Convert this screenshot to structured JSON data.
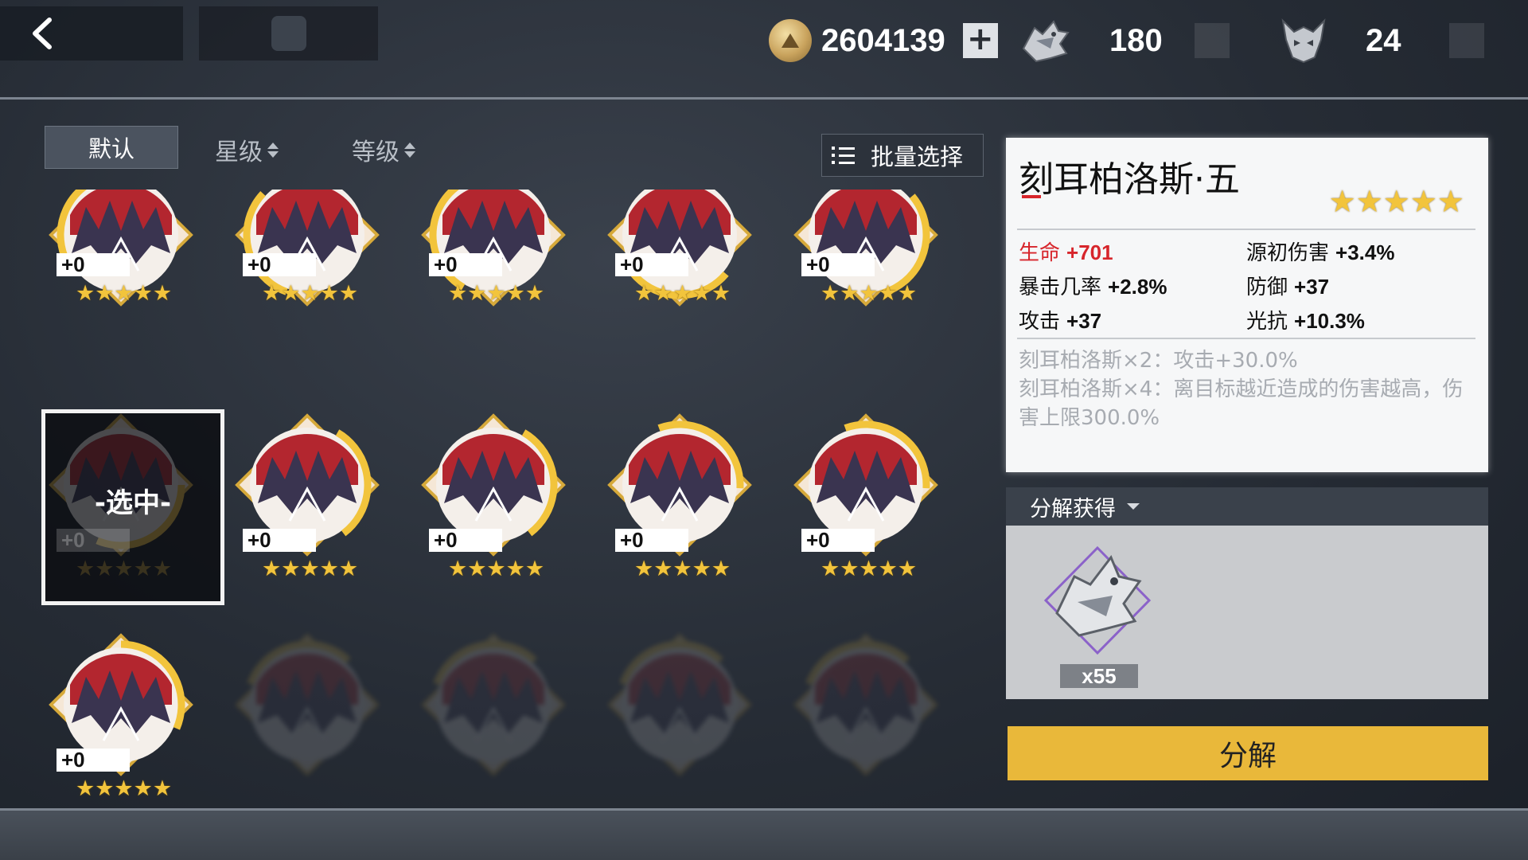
{
  "topbar": {
    "coins": "2604139",
    "dragon_currency": "180",
    "helm_currency": "24",
    "icons": {
      "back": "back-arrow-icon",
      "coin": "gold-coin-icon",
      "add": "plus-icon",
      "dragon": "dragon-crest-icon",
      "helm": "helm-crest-icon"
    }
  },
  "filters": {
    "default_label": "默认",
    "star_label": "星级",
    "level_label": "等级",
    "batch_label": "批量选择"
  },
  "grid": {
    "selected_text": "-选中-",
    "items": [
      {
        "level": "+0",
        "stars": "★★★★★",
        "selected": false
      },
      {
        "level": "+0",
        "stars": "★★★★★",
        "selected": false
      },
      {
        "level": "+0",
        "stars": "★★★★★",
        "selected": false
      },
      {
        "level": "+0",
        "stars": "★★★★★",
        "selected": false
      },
      {
        "level": "+0",
        "stars": "★★★★★",
        "selected": false
      },
      {
        "level": "+0",
        "stars": "★★★★★",
        "selected": true
      },
      {
        "level": "+0",
        "stars": "★★★★★",
        "selected": false
      },
      {
        "level": "+0",
        "stars": "★★★★★",
        "selected": false
      },
      {
        "level": "+0",
        "stars": "★★★★★",
        "selected": false
      },
      {
        "level": "+0",
        "stars": "★★★★★",
        "selected": false
      },
      {
        "level": "+0",
        "stars": "★★★★★",
        "selected": false
      }
    ]
  },
  "detail": {
    "name": "刻耳柏洛斯·五",
    "stars": "★★★★★",
    "stats": [
      {
        "label": "生命",
        "value": "+701",
        "highlight": true
      },
      {
        "label": "源初伤害",
        "value": "+3.4%",
        "highlight": false
      },
      {
        "label": "暴击几率",
        "value": "+2.8%",
        "highlight": false
      },
      {
        "label": "防御",
        "value": "+37",
        "highlight": false
      },
      {
        "label": "攻击",
        "value": "+37",
        "highlight": false
      },
      {
        "label": "光抗",
        "value": "+10.3%",
        "highlight": false
      }
    ],
    "set_effect_2": "刻耳柏洛斯×2：攻击+30.0%",
    "set_effect_4": "刻耳柏洛斯×4：离目标越近造成的伤害越高，伤害上限300.0%"
  },
  "decompose": {
    "header": "分解获得",
    "reward_icon": "dragon-crest-icon",
    "reward_count": "x55",
    "button_label": "分解"
  },
  "colors": {
    "accent_gold": "#e9b83a",
    "star": "#f2c43c",
    "highlight_red": "#d7252b",
    "panel_bg": "#f6f7f8"
  }
}
